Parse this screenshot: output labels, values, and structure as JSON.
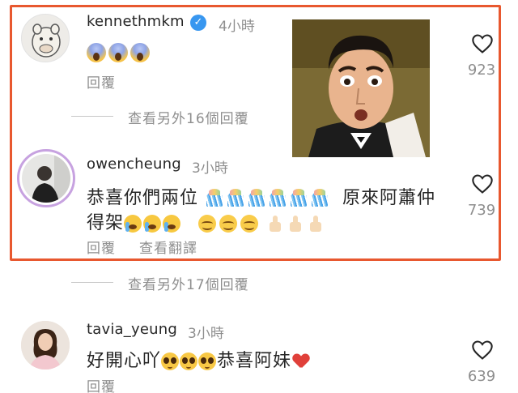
{
  "colors": {
    "highlight": "#e8582f",
    "muted": "#8e8e8e",
    "verified": "#3897f0"
  },
  "comments": [
    {
      "username": "kennethmkm",
      "verified": true,
      "time": "4小時",
      "text": "",
      "emojis": [
        "face-screaming-in-fear",
        "face-screaming-in-fear",
        "face-screaming-in-fear"
      ],
      "reply_label": "回覆",
      "likes": "923",
      "has_meme_image": true
    },
    {
      "username": "owencheung",
      "time": "3小時",
      "text_line1_prefix": "恭喜你們兩位",
      "text_line1_suffix": "原來阿蕭仲",
      "text_line2_prefix": "得架",
      "reply_label": "回覆",
      "translate_label": "查看翻譯",
      "likes": "739"
    },
    {
      "username": "tavia_yeung",
      "time": "3小時",
      "text_prefix": "好開心吖",
      "text_suffix": "恭喜阿妹",
      "reply_label": "回覆",
      "likes": "639"
    }
  ],
  "view_more_1": "查看另外16個回覆",
  "view_more_2": "查看另外17個回覆",
  "icons": {
    "like": "heart-outline-icon",
    "verified": "verified-badge-icon"
  }
}
